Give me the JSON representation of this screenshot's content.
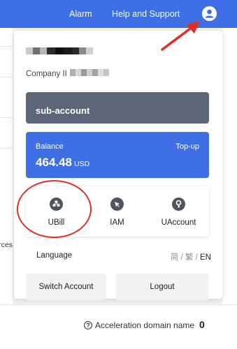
{
  "topbar": {
    "alarm": "Alarm",
    "help": "Help and Support",
    "user_icon": "user-circle-icon"
  },
  "background": {
    "cut_text": "rces",
    "accel_label": "Acceleration domain name",
    "accel_count": "0"
  },
  "account_panel": {
    "company_label": "Company II",
    "sub_account": "sub-account",
    "balance": {
      "label": "Balance",
      "topup": "Top-up",
      "amount": "464.48",
      "currency": "USD"
    },
    "shortcuts": [
      {
        "label": "UBill",
        "icon": "bill-icon"
      },
      {
        "label": "IAM",
        "icon": "iam-icon"
      },
      {
        "label": "UAccount",
        "icon": "account-key-icon"
      }
    ],
    "language": {
      "label": "Language",
      "options": [
        "简",
        "繁",
        "EN"
      ],
      "separator": "/",
      "selected": "EN"
    },
    "buttons": {
      "switch_account": "Switch Account",
      "logout": "Logout"
    }
  },
  "colors": {
    "topbar": "#3f6fe5",
    "sub_account_bg": "#5d6678",
    "balance_bg": "#3f6fe5",
    "annotation_red": "#e03026"
  }
}
